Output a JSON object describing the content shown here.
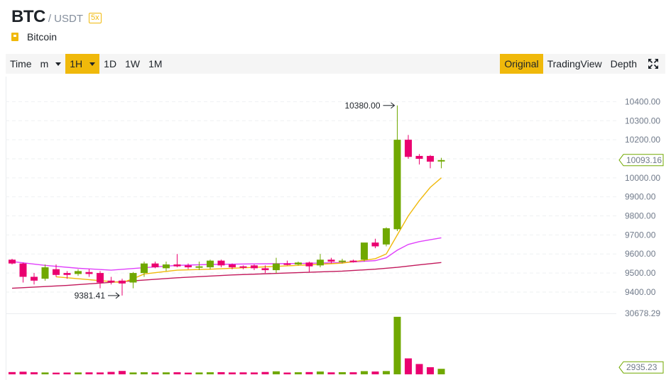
{
  "header": {
    "base": "BTC",
    "quote": "/ USDT",
    "leverage": "5x",
    "coin_name": "Bitcoin"
  },
  "toolbar": {
    "time_label": "Time",
    "minute_label": "m",
    "hour_label": "1H",
    "intervals": [
      "1D",
      "1W",
      "1M"
    ],
    "views": [
      "Original",
      "TradingView",
      "Depth"
    ],
    "active_view": "Original",
    "fullscreen_icon": "expand-icon"
  },
  "colors": {
    "up": "#70a800",
    "down": "#ea0070",
    "accent": "#f0b90b",
    "ma_short": "#f0b90b",
    "ma_mid": "#e040fb",
    "ma_long": "#c2185b"
  },
  "chart_data": {
    "type": "candlestick",
    "price_axis": {
      "ticks": [
        "10400.00",
        "10300.00",
        "10200.00",
        "10100.00",
        "10000.00",
        "9900.00",
        "9800.00",
        "9700.00",
        "9600.00",
        "9500.00",
        "9400.00"
      ],
      "range": [
        9370,
        10435
      ]
    },
    "current_price": "10093.16",
    "volume_axis": {
      "max_label": "30678.29",
      "current_label": "2935.23",
      "range": [
        0,
        31000
      ]
    },
    "annotations": {
      "high": "10380.00",
      "low": "9381.41"
    },
    "candles": [
      {
        "o": 9570,
        "h": 9575,
        "c": 9550,
        "l": 9545
      },
      {
        "o": 9550,
        "h": 9555,
        "c": 9480,
        "l": 9450
      },
      {
        "o": 9480,
        "h": 9500,
        "c": 9460,
        "l": 9440
      },
      {
        "o": 9470,
        "h": 9545,
        "c": 9530,
        "l": 9460
      },
      {
        "o": 9520,
        "h": 9545,
        "c": 9490,
        "l": 9480
      },
      {
        "o": 9500,
        "h": 9510,
        "c": 9490,
        "l": 9470
      },
      {
        "o": 9495,
        "h": 9520,
        "c": 9510,
        "l": 9485
      },
      {
        "o": 9505,
        "h": 9520,
        "c": 9495,
        "l": 9480
      },
      {
        "o": 9500,
        "h": 9510,
        "c": 9450,
        "l": 9420
      },
      {
        "o": 9460,
        "h": 9480,
        "c": 9455,
        "l": 9440
      },
      {
        "o": 9460,
        "h": 9470,
        "c": 9445,
        "l": 9381.41
      },
      {
        "o": 9450,
        "h": 9505,
        "c": 9500,
        "l": 9420
      },
      {
        "o": 9500,
        "h": 9560,
        "c": 9550,
        "l": 9480
      },
      {
        "o": 9550,
        "h": 9560,
        "c": 9530,
        "l": 9525
      },
      {
        "o": 9525,
        "h": 9560,
        "c": 9545,
        "l": 9510
      },
      {
        "o": 9545,
        "h": 9600,
        "c": 9535,
        "l": 9530
      },
      {
        "o": 9540,
        "h": 9550,
        "c": 9530,
        "l": 9520
      },
      {
        "o": 9530,
        "h": 9560,
        "c": 9535,
        "l": 9515
      },
      {
        "o": 9530,
        "h": 9570,
        "c": 9565,
        "l": 9520
      },
      {
        "o": 9565,
        "h": 9570,
        "c": 9540,
        "l": 9530
      },
      {
        "o": 9545,
        "h": 9550,
        "c": 9530,
        "l": 9520
      },
      {
        "o": 9535,
        "h": 9540,
        "c": 9530,
        "l": 9520
      },
      {
        "o": 9540,
        "h": 9545,
        "c": 9525,
        "l": 9515
      },
      {
        "o": 9525,
        "h": 9540,
        "c": 9515,
        "l": 9500
      },
      {
        "o": 9515,
        "h": 9580,
        "c": 9550,
        "l": 9500
      },
      {
        "o": 9550,
        "h": 9565,
        "c": 9545,
        "l": 9540
      },
      {
        "o": 9545,
        "h": 9560,
        "c": 9555,
        "l": 9540
      },
      {
        "o": 9555,
        "h": 9560,
        "c": 9535,
        "l": 9505
      },
      {
        "o": 9540,
        "h": 9600,
        "c": 9570,
        "l": 9530
      },
      {
        "o": 9570,
        "h": 9580,
        "c": 9560,
        "l": 9550
      },
      {
        "o": 9560,
        "h": 9575,
        "c": 9565,
        "l": 9550
      },
      {
        "o": 9565,
        "h": 9570,
        "c": 9560,
        "l": 9555
      },
      {
        "o": 9570,
        "h": 9640,
        "c": 9660,
        "l": 9560
      },
      {
        "o": 9660,
        "h": 9680,
        "c": 9640,
        "l": 9630
      },
      {
        "o": 9650,
        "h": 9740,
        "c": 9735,
        "l": 9640
      },
      {
        "o": 9730,
        "h": 10380,
        "c": 10200,
        "l": 9720
      },
      {
        "o": 10200,
        "h": 10225,
        "c": 10110,
        "l": 10100
      },
      {
        "o": 10115,
        "h": 10125,
        "c": 10100,
        "l": 10070
      },
      {
        "o": 10115,
        "h": 10120,
        "c": 10085,
        "l": 10050
      },
      {
        "o": 10090,
        "h": 10105,
        "c": 10093.16,
        "l": 10050
      }
    ],
    "volumes": [
      1200,
      1400,
      1100,
      1000,
      900,
      950,
      1000,
      1050,
      1000,
      1300,
      1800,
      1000,
      1100,
      1000,
      1050,
      1100,
      900,
      1000,
      1100,
      1150,
      1000,
      1050,
      1000,
      1250,
      1600,
      950,
      1100,
      1200,
      1500,
      1050,
      1150,
      1100,
      1700,
      1500,
      1750,
      30678.29,
      8500,
      5500,
      3800,
      2935.23
    ],
    "ma_short": [
      [
        4,
        9480
      ],
      [
        8,
        9460
      ],
      [
        10,
        9450
      ],
      [
        11,
        9470
      ],
      [
        12,
        9495
      ],
      [
        15,
        9515
      ],
      [
        18,
        9520
      ],
      [
        22,
        9530
      ],
      [
        26,
        9540
      ],
      [
        30,
        9552
      ],
      [
        33,
        9575
      ],
      [
        34,
        9600
      ],
      [
        35,
        9700
      ],
      [
        36,
        9800
      ],
      [
        37,
        9880
      ],
      [
        38,
        9950
      ],
      [
        39,
        10000
      ]
    ],
    "ma_mid": [
      [
        0,
        9560
      ],
      [
        3,
        9540
      ],
      [
        6,
        9525
      ],
      [
        9,
        9515
      ],
      [
        12,
        9528
      ],
      [
        15,
        9540
      ],
      [
        18,
        9545
      ],
      [
        22,
        9548
      ],
      [
        26,
        9550
      ],
      [
        30,
        9555
      ],
      [
        33,
        9565
      ],
      [
        34,
        9580
      ],
      [
        35,
        9620
      ],
      [
        36,
        9650
      ],
      [
        37,
        9665
      ],
      [
        39,
        9685
      ]
    ],
    "ma_long": [
      [
        0,
        9420
      ],
      [
        5,
        9435
      ],
      [
        10,
        9455
      ],
      [
        15,
        9475
      ],
      [
        20,
        9490
      ],
      [
        25,
        9500
      ],
      [
        30,
        9510
      ],
      [
        33,
        9520
      ],
      [
        35,
        9530
      ],
      [
        37,
        9543
      ],
      [
        39,
        9555
      ]
    ]
  }
}
